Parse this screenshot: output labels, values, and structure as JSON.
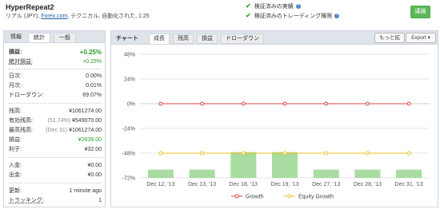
{
  "header": {
    "title": "HyperRepeat2",
    "subtitle_prefix": "リアル (JPY), ",
    "broker_link": "Forex.com",
    "subtitle_suffix": ", テクニカル, 自動化された, 1:25",
    "verified_track": "検証済みの実績",
    "verified_trading": "検証済みのトレーディング権限",
    "action_button": "議論"
  },
  "left_panel": {
    "tabs": [
      "情報",
      "統計",
      "一般"
    ],
    "active_tab": "統計",
    "stats": [
      {
        "key": "損益:",
        "value": "+0.25%",
        "style": "big"
      },
      {
        "key": "絶対損益:",
        "value": "+0.25%",
        "style": "green"
      },
      {
        "key": "日次:",
        "value": "0.00%"
      },
      {
        "key": "月次:",
        "value": "0.01%"
      },
      {
        "key": "ドローダウン:",
        "value": "69.07%"
      },
      {
        "key": "残高:",
        "value": "¥1061274.00"
      },
      {
        "key": "有効残高:",
        "note": "(51.74%)",
        "value": "¥549070.00"
      },
      {
        "key": "最高残高:",
        "note": "(Dec 31)",
        "value": "¥1061274.00"
      },
      {
        "key": "損益:",
        "value": "¥2639.00",
        "style": "green"
      },
      {
        "key": "利子:",
        "value": "¥32.00"
      },
      {
        "key": "入金:",
        "value": "¥0.00"
      },
      {
        "key": "出金:",
        "value": "¥0.00"
      },
      {
        "key": "更新:",
        "value": "1 minute ago"
      },
      {
        "key": "トラッキング:",
        "value": "1"
      }
    ]
  },
  "chart_panel": {
    "label": "チャート",
    "tabs": [
      "成長",
      "残高",
      "損益",
      "ドローダウン"
    ],
    "active_tab": "成長",
    "zoom_button": "もっと拡",
    "export_button": "Export"
  },
  "chart_data": {
    "type": "bar+line",
    "categories": [
      "Dec 12, '13",
      "Dec 13, '13",
      "Dec 18, '13",
      "Dec 19, '13",
      "Dec 27, '13",
      "Dec 28, '13",
      "Dec 31, '13"
    ],
    "y_ticks": [
      "48%",
      "24%",
      "0%",
      "-24%",
      "-48%",
      "-72%"
    ],
    "ylim": [
      -72,
      48
    ],
    "bars": [
      -64,
      -64,
      -47,
      -47,
      -64,
      -64,
      -64
    ],
    "series": [
      {
        "name": "Growth",
        "values": [
          0,
          0,
          0,
          0,
          0,
          0,
          0
        ],
        "color": "#dd4444"
      },
      {
        "name": "Equity Growth",
        "values": [
          -48,
          -48,
          -48,
          -48,
          -48,
          -48,
          -48
        ],
        "color": "#f0c020"
      }
    ],
    "bar_color": "#a8dca0",
    "grid": true,
    "legend": "bottom"
  }
}
